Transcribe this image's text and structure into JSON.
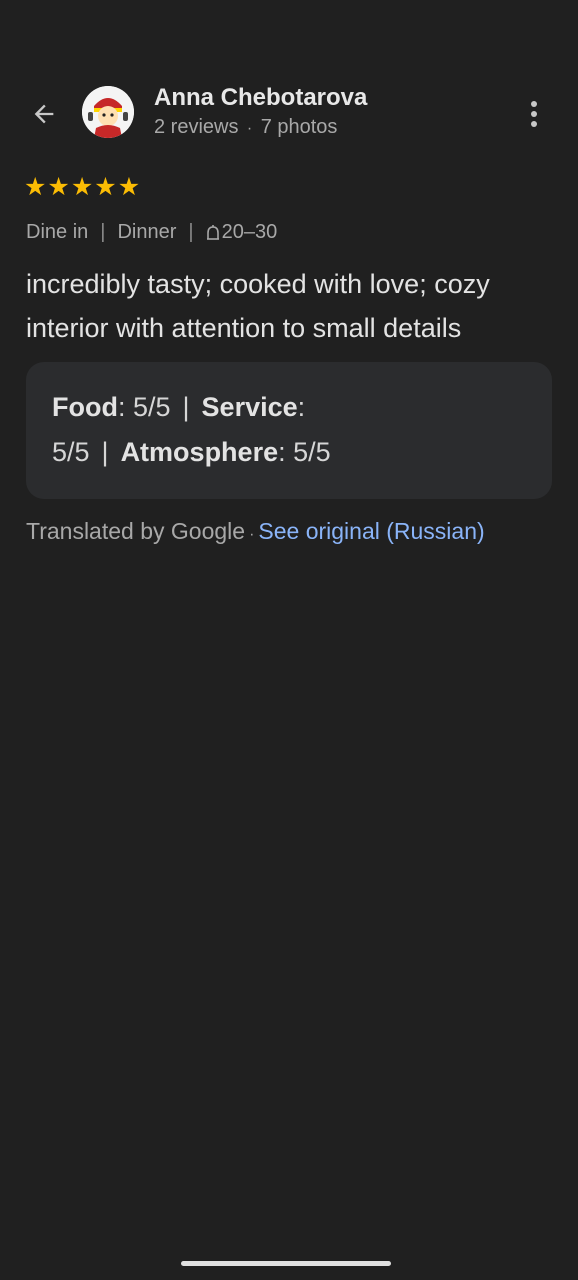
{
  "reviewer": {
    "name": "Anna Chebotarova",
    "reviews_count": "2 reviews",
    "photos_count": "7 photos"
  },
  "rating": {
    "stars": 5,
    "max_stars": 5,
    "star_glyph": "★"
  },
  "tags": {
    "service_type": "Dine in",
    "meal_type": "Dinner",
    "price_range": "20–30"
  },
  "review_text": "incredibly tasty; cooked with love; cozy interior with attention to small details",
  "sub_ratings": {
    "food_label": "Food",
    "food_value": ": 5/5",
    "service_label": "Service",
    "service_value": "5/5",
    "atmosphere_label": "Atmosphere",
    "atmosphere_value": ": 5/5"
  },
  "translation": {
    "translated_by": "Translated by Google",
    "see_original": "See original (Russian)"
  },
  "icons": {
    "back": "arrow-back-icon",
    "more": "more-vert-icon",
    "price": "price-icon"
  },
  "colors": {
    "background": "#202020",
    "star": "#fbbc04",
    "link": "#8ab4f8",
    "card": "#2b2c2e"
  }
}
